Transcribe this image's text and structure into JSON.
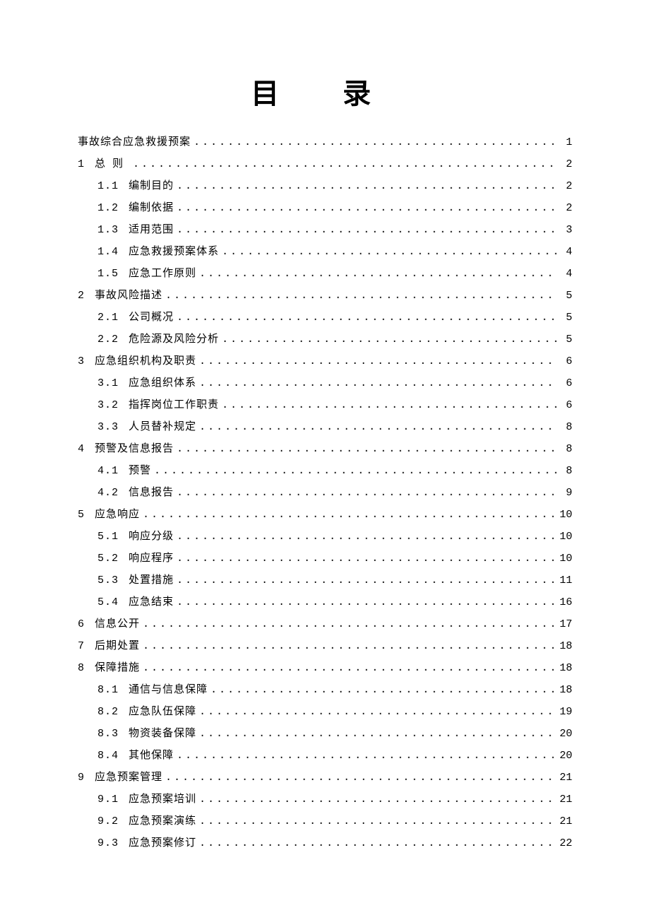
{
  "title": "目 录",
  "toc": [
    {
      "level": 0,
      "num": "",
      "label": "事故综合应急救援预案",
      "page": "1"
    },
    {
      "level": 1,
      "num": "1",
      "label": "总则",
      "spaced": true,
      "page": "2"
    },
    {
      "level": 2,
      "num": "1.1",
      "label": "编制目的",
      "page": "2"
    },
    {
      "level": 2,
      "num": "1.2",
      "label": "编制依据",
      "page": "2"
    },
    {
      "level": 2,
      "num": "1.3",
      "label": "适用范围",
      "page": "3"
    },
    {
      "level": 2,
      "num": "1.4",
      "label": "应急救援预案体系",
      "page": "4"
    },
    {
      "level": 2,
      "num": "1.5",
      "label": "应急工作原则",
      "page": "4"
    },
    {
      "level": 1,
      "num": "2",
      "label": "事故风险描述",
      "page": "5"
    },
    {
      "level": 2,
      "num": "2.1",
      "label": "公司概况",
      "page": "5"
    },
    {
      "level": 2,
      "num": "2.2",
      "label": "危险源及风险分析",
      "page": "5"
    },
    {
      "level": 1,
      "num": "3",
      "label": "应急组织机构及职责",
      "page": "6"
    },
    {
      "level": 2,
      "num": "3.1",
      "label": "应急组织体系",
      "page": "6"
    },
    {
      "level": 2,
      "num": "3.2",
      "label": "指挥岗位工作职责",
      "page": "6"
    },
    {
      "level": 2,
      "num": "3.3",
      "label": "人员替补规定",
      "page": "8"
    },
    {
      "level": 1,
      "num": "4",
      "label": "预警及信息报告",
      "page": "8"
    },
    {
      "level": 2,
      "num": "4.1",
      "label": "预警",
      "page": "8"
    },
    {
      "level": 2,
      "num": "4.2",
      "label": "信息报告",
      "page": "9"
    },
    {
      "level": 1,
      "num": "5",
      "label": "应急响应",
      "page": "10"
    },
    {
      "level": 2,
      "num": "5.1",
      "label": "响应分级",
      "page": "10"
    },
    {
      "level": 2,
      "num": "5.2",
      "label": "响应程序",
      "page": "10"
    },
    {
      "level": 2,
      "num": "5.3",
      "label": "处置措施",
      "page": "11"
    },
    {
      "level": 2,
      "num": "5.4",
      "label": "应急结束",
      "page": "16"
    },
    {
      "level": 1,
      "num": "6",
      "label": "信息公开",
      "page": "17"
    },
    {
      "level": 1,
      "num": "7",
      "label": "后期处置",
      "page": "18"
    },
    {
      "level": 1,
      "num": "8",
      "label": "保障措施",
      "page": "18"
    },
    {
      "level": 2,
      "num": "8.1",
      "label": "通信与信息保障",
      "page": "18"
    },
    {
      "level": 2,
      "num": "8.2",
      "label": "应急队伍保障",
      "page": "19"
    },
    {
      "level": 2,
      "num": "8.3",
      "label": "物资装备保障",
      "page": "20"
    },
    {
      "level": 2,
      "num": "8.4",
      "label": "其他保障",
      "page": "20"
    },
    {
      "level": 1,
      "num": "9",
      "label": "应急预案管理",
      "page": "21"
    },
    {
      "level": 2,
      "num": "9.1",
      "label": "应急预案培训",
      "page": "21"
    },
    {
      "level": 2,
      "num": "9.2",
      "label": "应急预案演练",
      "page": "21"
    },
    {
      "level": 2,
      "num": "9.3",
      "label": "应急预案修订",
      "page": "22"
    }
  ]
}
